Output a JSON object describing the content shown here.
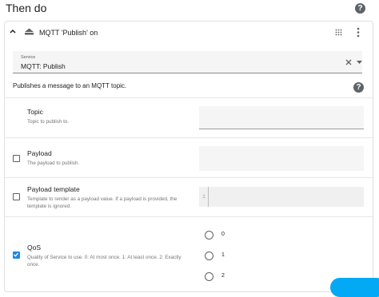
{
  "header": {
    "title": "Then do",
    "help_label": "?"
  },
  "action": {
    "title": "MQTT 'Publish' on"
  },
  "service": {
    "label": "Service",
    "value": "MQTT: Publish",
    "description": "Publishes a message to an MQTT topic."
  },
  "help_label": "?",
  "fields": {
    "topic": {
      "name": "Topic",
      "description": "Topic to publish to."
    },
    "payload": {
      "name": "Payload",
      "description": "The payload to publish.",
      "checked": false
    },
    "payload_template": {
      "name": "Payload template",
      "description_line1": "Template to render as a payload value. If a payload is provided, the",
      "description_line2": "template is ignored.",
      "line_number": "1",
      "checked": false
    },
    "qos": {
      "name": "QoS",
      "description_line1": "Quality of Service to use. 0: At most once. 1: At least once. 2: Exactly",
      "description_line2": "once.",
      "checked": true,
      "options": [
        "0",
        "1",
        "2"
      ]
    }
  },
  "colors": {
    "accent": "#1e88e5",
    "fab": "#03a9f4"
  }
}
